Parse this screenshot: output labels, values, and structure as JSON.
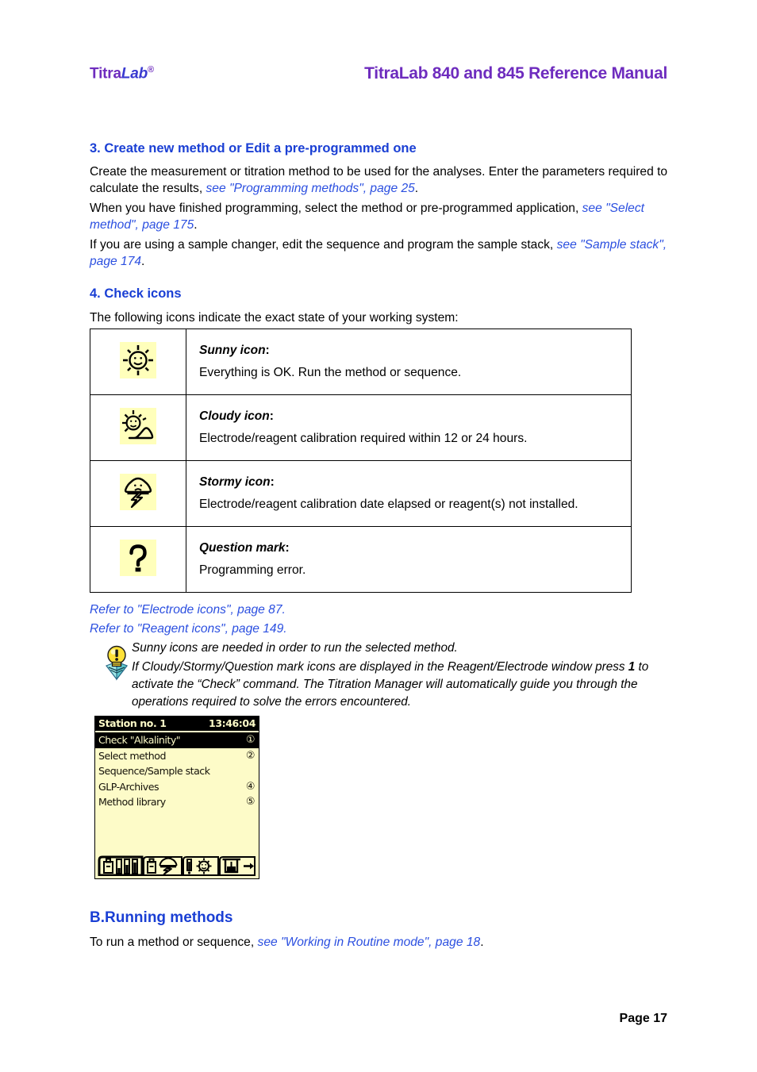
{
  "header": {
    "logo_titra": "Titra",
    "logo_lab": "Lab",
    "logo_reg": "®",
    "title": "TitraLab 840 and 845 Reference Manual",
    "brand_color": "#6e2cbe",
    "logo_lab_color": "#3a3ad0"
  },
  "section3": {
    "heading": "3. Create new method or Edit a pre-programmed one",
    "para1_lead": "Create the measurement or titration method to be used for the analyses. Enter the parameters required to calculate the results, ",
    "para1_xref": "see \"Programming methods\", page 25",
    "para1_tail": ".",
    "para2_lead": "When you have finished programming, select the method or pre-programmed application, ",
    "para2_xref": "see \"Select method\", page 175",
    "para2_tail": ".",
    "para3_lead": "If you are using a sample changer, edit the sequence and program the sample stack, ",
    "para3_xref": "see \"Sample stack\", page 174",
    "para3_tail": "."
  },
  "section4": {
    "heading": "4.  Check icons",
    "intro": "The following icons indicate the exact state of your working system:",
    "heading_color": "#1a3fd4",
    "icon_bg": "#ffffbb",
    "table": {
      "rows": [
        {
          "icon": "sunny-icon",
          "title": "Sunny icon",
          "colon": ":",
          "desc": "Everything is OK. Run the method or sequence."
        },
        {
          "icon": "cloudy-icon",
          "title": "Cloudy icon",
          "colon": ":",
          "desc": "Electrode/reagent calibration required within 12 or 24 hours."
        },
        {
          "icon": "stormy-icon",
          "title": "Stormy icon",
          "colon": ":",
          "desc": "Electrode/reagent calibration date elapsed or reagent(s) not installed."
        },
        {
          "icon": "question-mark-icon",
          "title": "Question mark",
          "colon": ":",
          "desc": "Programming error."
        }
      ]
    },
    "refer1": "Refer to \"Electrode icons\", page 87.",
    "refer2": "Refer to \"Reagent icons\", page 149.",
    "note_icon": "lightbulb-tip-icon",
    "note_line1": "Sunny icons are needed in order to run the selected method.",
    "note_line2_a": "If Cloudy/Stormy/Question mark icons are displayed in the Reagent/Electrode window press ",
    "note_line2_b": "1",
    "note_line2_c": " to activate the “Check” command. The Titration Manager will automatically guide you through the operations required to solve the errors encountered."
  },
  "lcd": {
    "station": "Station no. 1",
    "time": "13:46:04",
    "bg_color": "#fdfbc8",
    "menu": [
      {
        "label": "Check \"Alkalinity\"",
        "number": "①",
        "selected": true
      },
      {
        "label": "Select method",
        "number": "②",
        "selected": false
      },
      {
        "label": "Sequence/Sample stack",
        "number": "",
        "selected": false
      },
      {
        "label": "GLP-Archives",
        "number": "④",
        "selected": false
      },
      {
        "label": "Method library",
        "number": "⑤",
        "selected": false
      }
    ],
    "toolbar": [
      "reagent-electrode-button",
      "reagent-stormy-button",
      "electrode-sunny-button",
      "sample-transfer-button"
    ]
  },
  "sectionB": {
    "heading": "B.Running methods",
    "para_lead": "To run a method or sequence,  ",
    "para_xref": "see \"Working in Routine mode\", page 18",
    "para_tail": "."
  },
  "footer": {
    "page_label": "Page 17"
  }
}
